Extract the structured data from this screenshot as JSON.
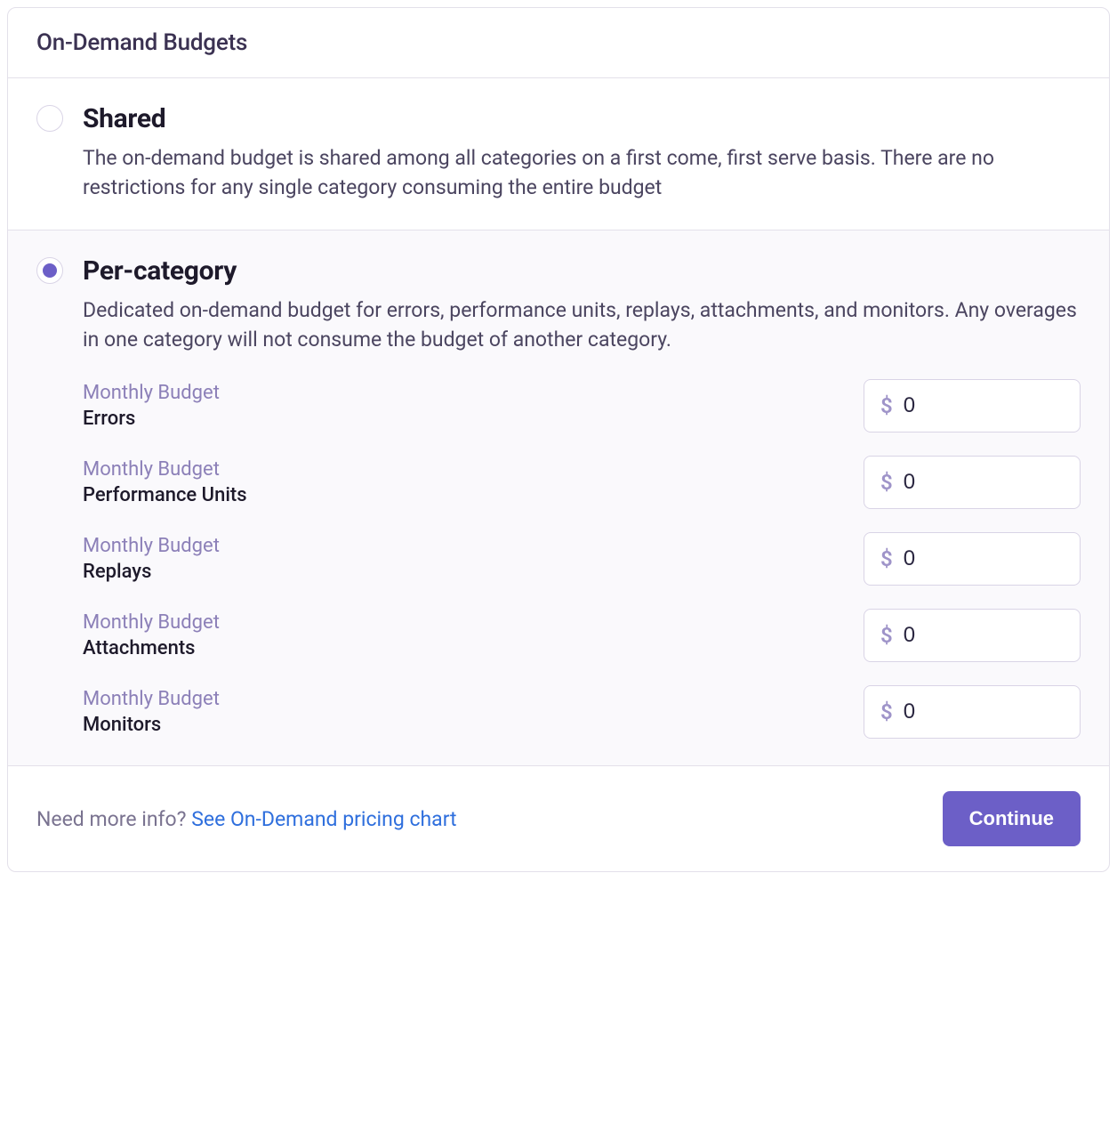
{
  "header": {
    "title": "On-Demand Budgets"
  },
  "options": {
    "shared": {
      "title": "Shared",
      "description": "The on-demand budget is shared among all categories on a first come, first serve basis. There are no restrictions for any single category consuming the entire budget",
      "selected": false
    },
    "per_category": {
      "title": "Per-category",
      "description": "Dedicated on-demand budget for errors, performance units, replays, attachments, and monitors. Any overages in one category will not consume the budget of another category.",
      "selected": true
    }
  },
  "budget_prefix": "Monthly Budget",
  "currency_symbol": "$",
  "budgets": [
    {
      "name": "Errors",
      "value": "0"
    },
    {
      "name": "Performance Units",
      "value": "0"
    },
    {
      "name": "Replays",
      "value": "0"
    },
    {
      "name": "Attachments",
      "value": "0"
    },
    {
      "name": "Monitors",
      "value": "0"
    }
  ],
  "footer": {
    "text": "Need more info? ",
    "link_text": "See On-Demand pricing chart",
    "button": "Continue"
  }
}
